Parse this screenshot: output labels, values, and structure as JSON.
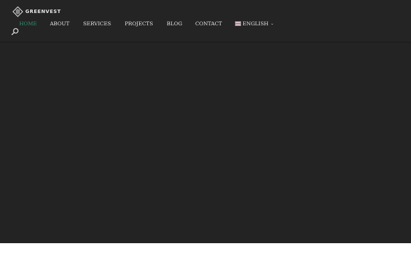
{
  "brand": {
    "name": "GREENVEST"
  },
  "nav": {
    "items": [
      {
        "label": "HOME",
        "active": true
      },
      {
        "label": "ABOUT"
      },
      {
        "label": "SERVICES"
      },
      {
        "label": "PROJECTS"
      },
      {
        "label": "BLOG"
      },
      {
        "label": "CONTACT"
      }
    ],
    "language": {
      "label": "ENGLISH",
      "flag": "uk-flag-icon"
    }
  },
  "search": {
    "icon": "search-icon"
  },
  "colors": {
    "header_bg": "#242424",
    "hero_bg": "#232323",
    "active_nav": "#2f8f6f",
    "nav_text": "#e6e6e6"
  }
}
